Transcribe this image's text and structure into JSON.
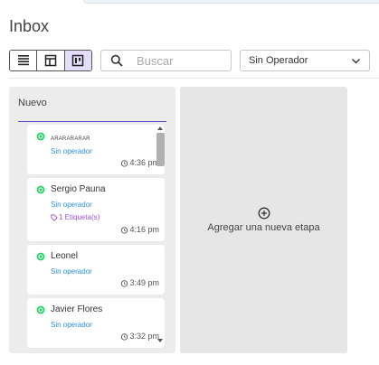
{
  "page": {
    "title": "Inbox"
  },
  "view_toggle": {
    "options": [
      "list-view",
      "table-view",
      "kanban-view"
    ],
    "active": "kanban-view"
  },
  "search": {
    "placeholder": "Buscar",
    "value": ""
  },
  "operator_filter": {
    "selected": "Sin Operador"
  },
  "columns": [
    {
      "title": "Nuevo",
      "cards": [
        {
          "name": "ARARARARAR",
          "operator": "Sin operador",
          "tag": "",
          "time": "4:36 pm",
          "channel": "whatsapp"
        },
        {
          "name": "Sergio Pauna",
          "operator": "Sin operador",
          "tag": "1 Etiqueta(s)",
          "time": "4:16 pm",
          "channel": "whatsapp"
        },
        {
          "name": "Leonel",
          "operator": "Sin operador",
          "tag": "",
          "time": "3:49 pm",
          "channel": "whatsapp"
        },
        {
          "name": "Javier Flores",
          "operator": "Sin operador",
          "tag": "",
          "time": "3:32 pm",
          "channel": "whatsapp"
        }
      ]
    }
  ],
  "add_stage": {
    "label": "Agregar una nueva etapa"
  },
  "colors": {
    "accent": "#5b52c9",
    "operator_text": "#2e8fd6",
    "tag_text": "#9b52d8",
    "whatsapp": "#25d366",
    "active_toggle": "#e4defb"
  }
}
